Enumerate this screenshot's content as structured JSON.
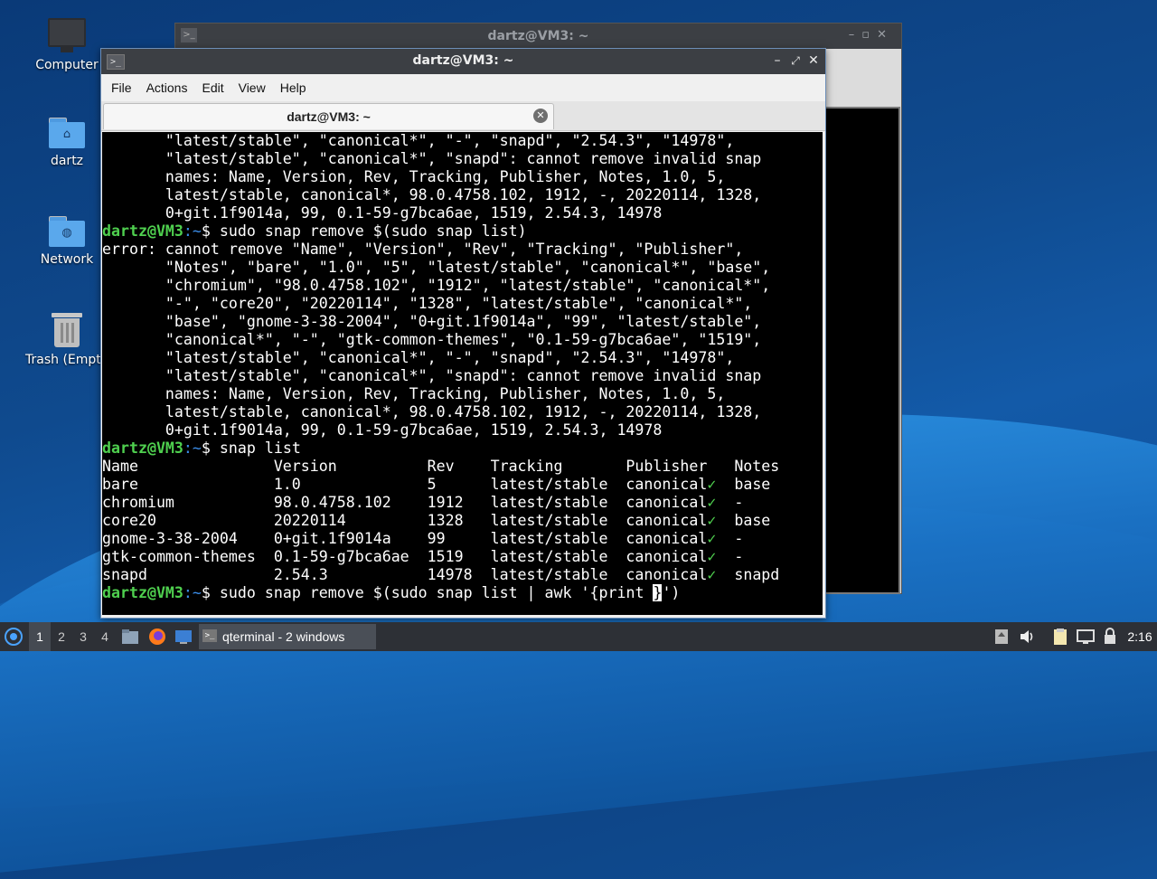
{
  "desktop": {
    "icons": [
      {
        "label": "Computer",
        "icon": "computer-icon"
      },
      {
        "label": "dartz",
        "icon": "home-folder-icon"
      },
      {
        "label": "Network",
        "icon": "network-folder-icon"
      },
      {
        "label": "Trash (Empty)",
        "icon": "trash-icon"
      }
    ]
  },
  "background_window": {
    "title": "dartz@VM3: ~"
  },
  "window": {
    "title": "dartz@VM3: ~",
    "menu": [
      "File",
      "Actions",
      "Edit",
      "View",
      "Help"
    ],
    "tab_label": "dartz@VM3: ~",
    "prompt_user": "dartz@VM3",
    "prompt_path": ":~",
    "prompt_sign": "$ "
  },
  "terminal": {
    "lines_top": [
      "       \"latest/stable\", \"canonical*\", \"-\", \"snapd\", \"2.54.3\", \"14978\",",
      "       \"latest/stable\", \"canonical*\", \"snapd\": cannot remove invalid snap",
      "       names: Name, Version, Rev, Tracking, Publisher, Notes, 1.0, 5,",
      "       latest/stable, canonical*, 98.0.4758.102, 1912, -, 20220114, 1328,",
      "       0+git.1f9014a, 99, 0.1-59-g7bca6ae, 1519, 2.54.3, 14978"
    ],
    "cmd1": "sudo snap remove $(sudo snap list)",
    "error_lines": [
      "error: cannot remove \"Name\", \"Version\", \"Rev\", \"Tracking\", \"Publisher\",",
      "       \"Notes\", \"bare\", \"1.0\", \"5\", \"latest/stable\", \"canonical*\", \"base\",",
      "       \"chromium\", \"98.0.4758.102\", \"1912\", \"latest/stable\", \"canonical*\",",
      "       \"-\", \"core20\", \"20220114\", \"1328\", \"latest/stable\", \"canonical*\",",
      "       \"base\", \"gnome-3-38-2004\", \"0+git.1f9014a\", \"99\", \"latest/stable\",",
      "       \"canonical*\", \"-\", \"gtk-common-themes\", \"0.1-59-g7bca6ae\", \"1519\",",
      "       \"latest/stable\", \"canonical*\", \"-\", \"snapd\", \"2.54.3\", \"14978\",",
      "       \"latest/stable\", \"canonical*\", \"snapd\": cannot remove invalid snap",
      "       names: Name, Version, Rev, Tracking, Publisher, Notes, 1.0, 5,",
      "       latest/stable, canonical*, 98.0.4758.102, 1912, -, 20220114, 1328,",
      "       0+git.1f9014a, 99, 0.1-59-g7bca6ae, 1519, 2.54.3, 14978"
    ],
    "cmd2": "snap list",
    "snap_header": "Name               Version          Rev    Tracking       Publisher   Notes",
    "snap_rows": [
      {
        "pre": "bare               1.0              5      latest/stable  canonical",
        "post": "  base"
      },
      {
        "pre": "chromium           98.0.4758.102    1912   latest/stable  canonical",
        "post": "  -"
      },
      {
        "pre": "core20             20220114         1328   latest/stable  canonical",
        "post": "  base"
      },
      {
        "pre": "gnome-3-38-2004    0+git.1f9014a    99     latest/stable  canonical",
        "post": "  -"
      },
      {
        "pre": "gtk-common-themes  0.1-59-g7bca6ae  1519   latest/stable  canonical",
        "post": "  -"
      },
      {
        "pre": "snapd              2.54.3           14978  latest/stable  canonical",
        "post": "  snapd"
      }
    ],
    "check_mark": "✓",
    "cmd3_before_cursor": "sudo snap remove $(sudo snap list | awk '{print ",
    "cmd3_cursor": "}",
    "cmd3_after_cursor": "')"
  },
  "taskbar": {
    "workspaces": [
      "1",
      "2",
      "3",
      "4"
    ],
    "active_workspace": "1",
    "task_label": "qterminal - 2 windows",
    "clock": "2:16"
  }
}
